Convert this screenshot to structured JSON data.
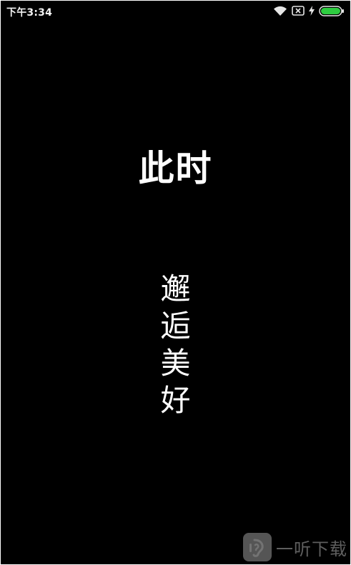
{
  "status_bar": {
    "time": "下午3:34",
    "icons": [
      "wifi-icon",
      "sim-card-icon",
      "charging-bolt-icon",
      "battery-icon"
    ],
    "battery_color": "#2ecc40"
  },
  "content": {
    "title": "此时",
    "subtitle_chars": [
      "邂",
      "逅",
      "美",
      "好"
    ]
  },
  "watermark": {
    "logo_icon": "ear-logo-icon",
    "text": "一听下载"
  },
  "colors": {
    "background": "#000000",
    "text": "#ffffff"
  }
}
